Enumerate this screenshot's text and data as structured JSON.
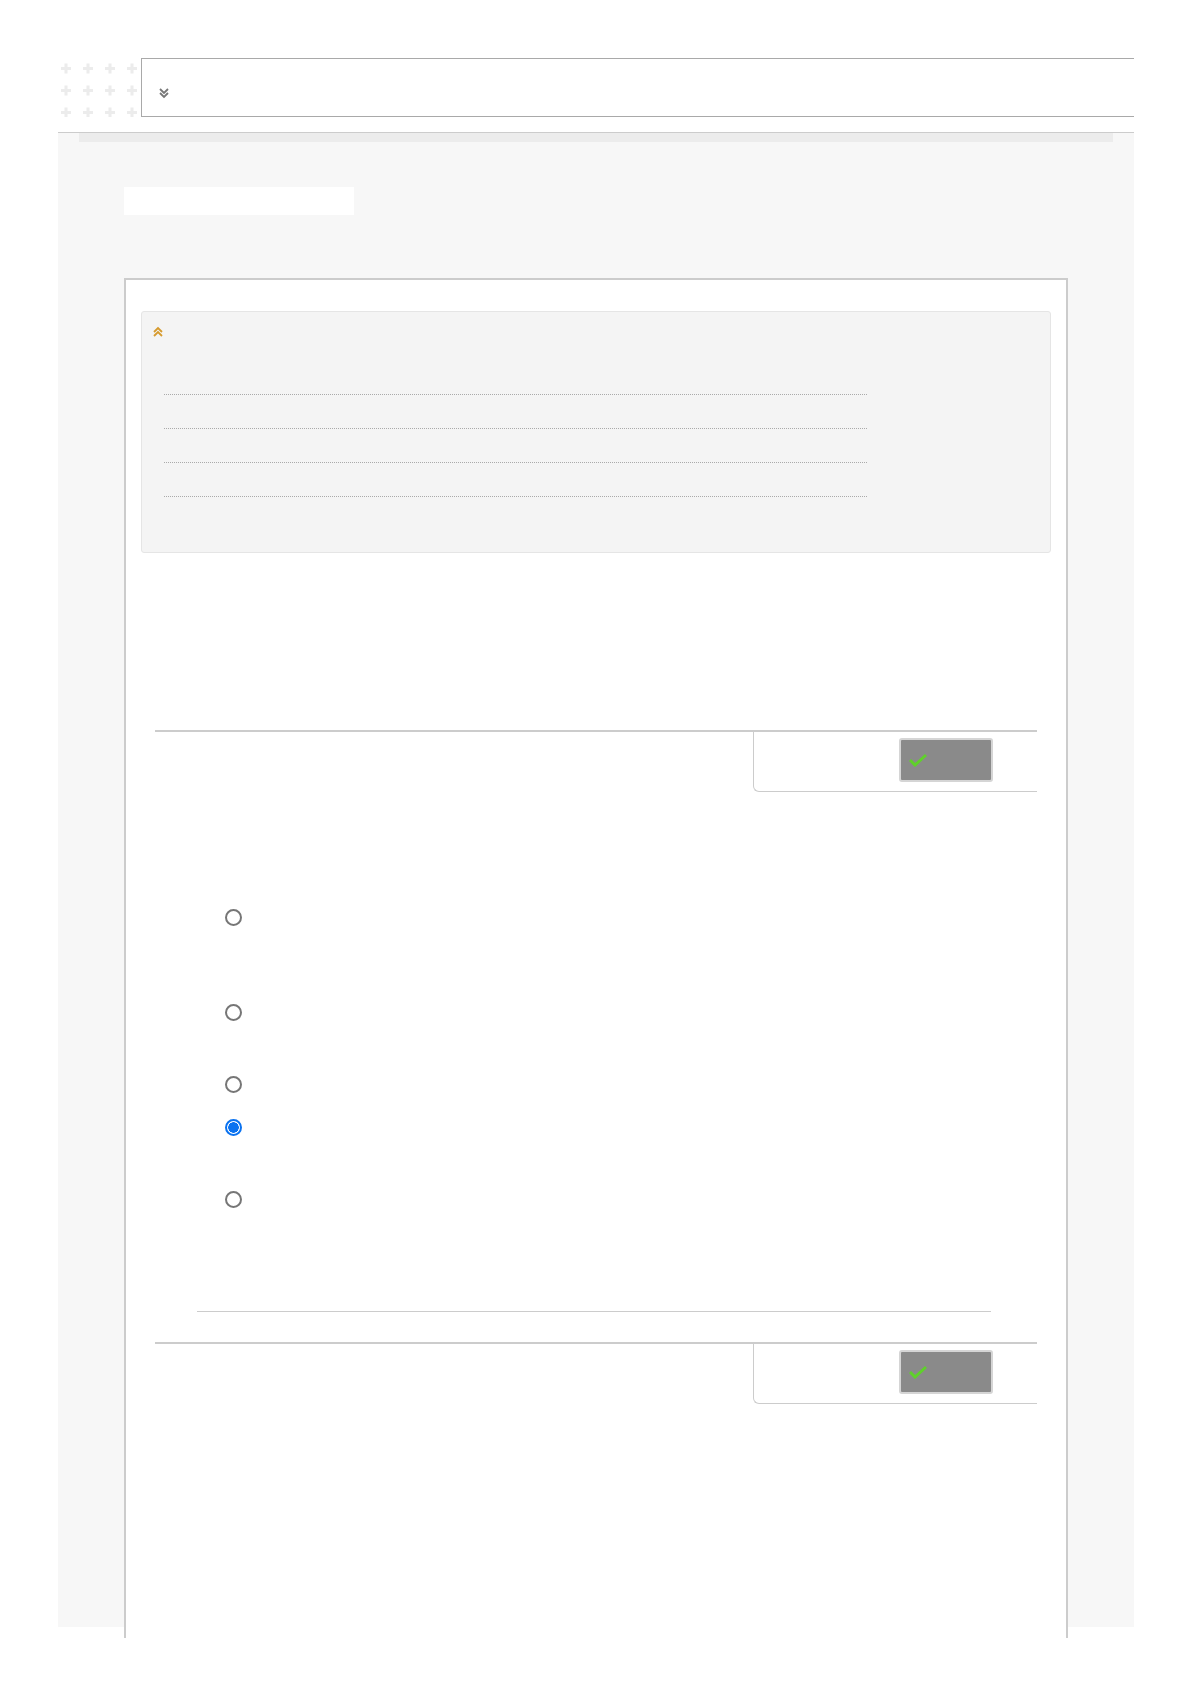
{
  "questions": [
    {
      "kind": "choice",
      "options": [
        {
          "selected": false
        },
        {
          "selected": false
        },
        {
          "selected": false
        },
        {
          "selected": true
        },
        {
          "selected": false
        }
      ]
    },
    {
      "kind": "choice"
    }
  ]
}
